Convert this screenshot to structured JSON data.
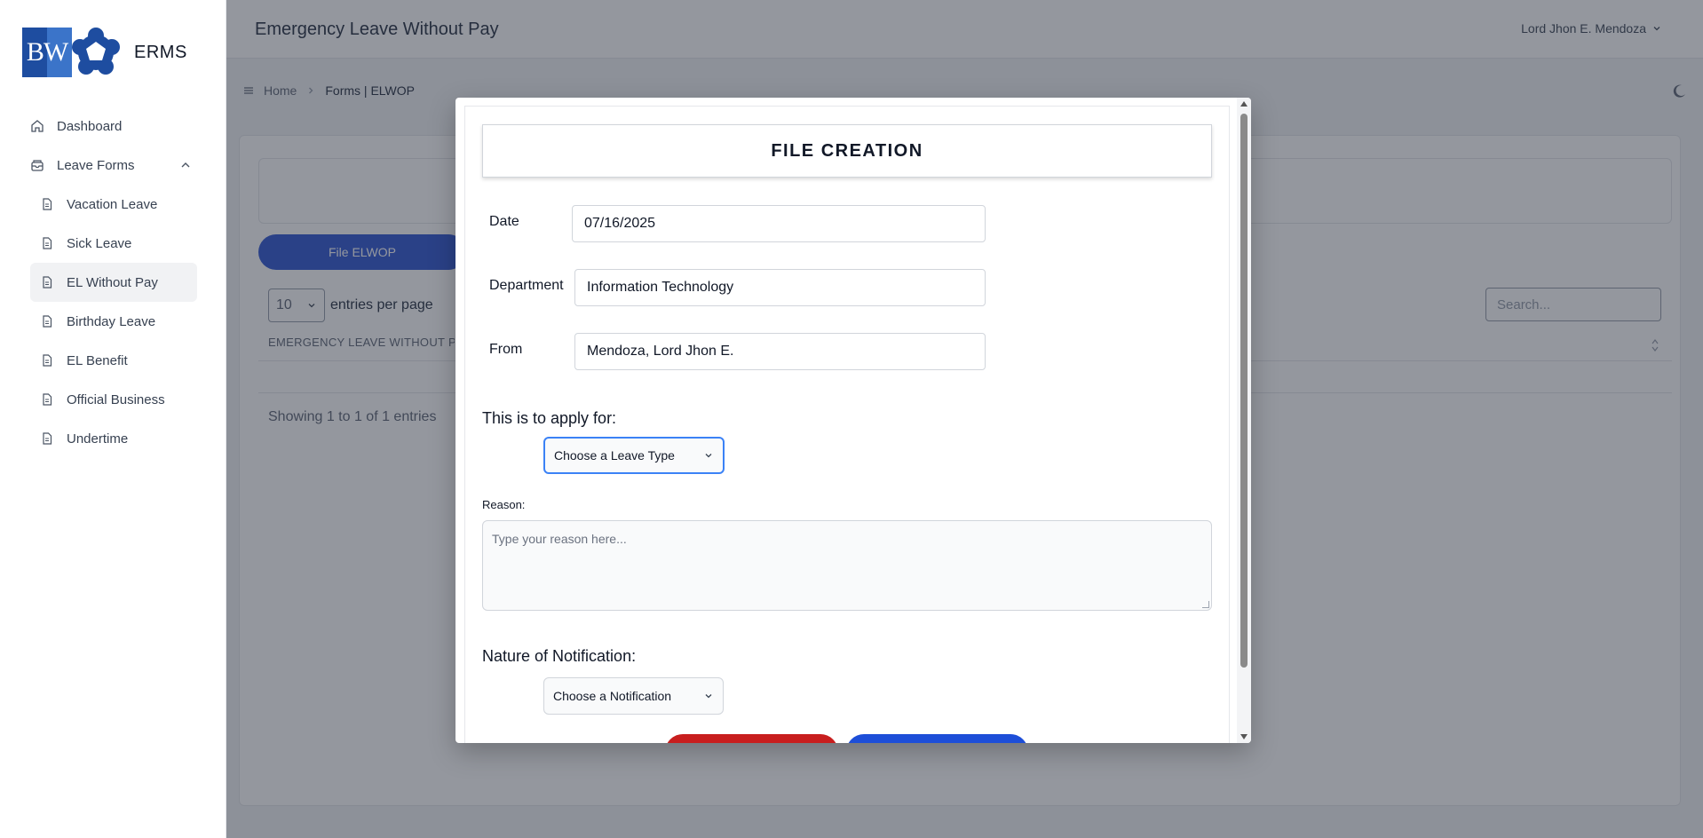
{
  "app": {
    "name": "ERMS",
    "logo_text": "BW"
  },
  "sidebar": {
    "items": [
      {
        "label": "Dashboard"
      },
      {
        "label": "Leave Forms"
      }
    ],
    "sub_items": [
      {
        "label": "Vacation Leave"
      },
      {
        "label": "Sick Leave"
      },
      {
        "label": "EL Without Pay",
        "active": true
      },
      {
        "label": "Birthday Leave"
      },
      {
        "label": "EL Benefit"
      },
      {
        "label": "Official Business"
      },
      {
        "label": "Undertime"
      }
    ]
  },
  "header": {
    "title": "Emergency Leave Without Pay",
    "user": "Lord Jhon E. Mendoza"
  },
  "breadcrumb": {
    "home": "Home",
    "current": "Forms | ELWOP"
  },
  "page": {
    "file_button": "File ELWOP",
    "per_page_value": "10",
    "per_page_label": "entries per page",
    "search_placeholder": "Search...",
    "column_header": "EMERGENCY LEAVE WITHOUT PAY",
    "showing": "Showing 1 to 1 of 1 entries"
  },
  "modal": {
    "title": "FILE CREATION",
    "date_label": "Date",
    "date_value": "07/16/2025",
    "department_label": "Department",
    "department_value": "Information Technology",
    "from_label": "From",
    "from_value": "Mendoza, Lord Jhon E.",
    "apply_label": "This is to apply for:",
    "leave_type_value": "Choose a Leave Type",
    "reason_label": "Reason:",
    "reason_placeholder": "Type your reason here...",
    "notification_label": "Nature of Notification:",
    "notification_value": "Choose a Notification"
  },
  "colors": {
    "primary_blue": "#1d4ed8",
    "danger_red": "#c81e1e",
    "focus_blue": "#3b82f6",
    "logo_blue": "#1e4da0"
  }
}
